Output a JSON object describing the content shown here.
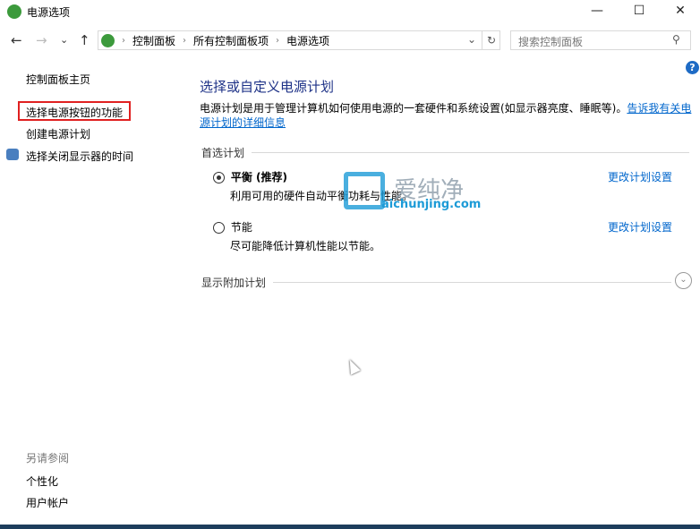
{
  "window": {
    "title": "电源选项",
    "minimize": "—",
    "maximize": "☐",
    "close": "✕"
  },
  "nav": {
    "back": "←",
    "forward": "→",
    "recent": "⌄",
    "up": "↑",
    "refresh": "↻",
    "dropdown": "⌄"
  },
  "breadcrumb": [
    "控制面板",
    "所有控制面板项",
    "电源选项"
  ],
  "search": {
    "placeholder": "搜索控制面板",
    "icon": "⚲"
  },
  "sidebar": {
    "items": [
      "控制面板主页",
      "选择电源按钮的功能",
      "创建电源计划",
      "选择关闭显示器的时间"
    ],
    "see_also_title": "另请参阅",
    "see_also": [
      "个性化",
      "用户帐户"
    ]
  },
  "main": {
    "heading": "选择或自定义电源计划",
    "description": "电源计划是用于管理计算机如何使用电源的一套硬件和系统设置(如显示器亮度、睡眠等)。",
    "details_link": "告诉我有关电源计划的详细信息",
    "preferred_header": "首选计划",
    "plans": [
      {
        "name": "平衡 (推荐)",
        "desc": "利用可用的硬件自动平衡功耗与性能。",
        "selected": true,
        "link": "更改计划设置"
      },
      {
        "name": "节能",
        "desc": "尽可能降低计算机性能以节能。",
        "selected": false,
        "link": "更改计划设置"
      }
    ],
    "additional_header": "显示附加计划",
    "help": "?"
  },
  "watermark": {
    "text": "爱纯净",
    "url": "aichunjing.com"
  }
}
